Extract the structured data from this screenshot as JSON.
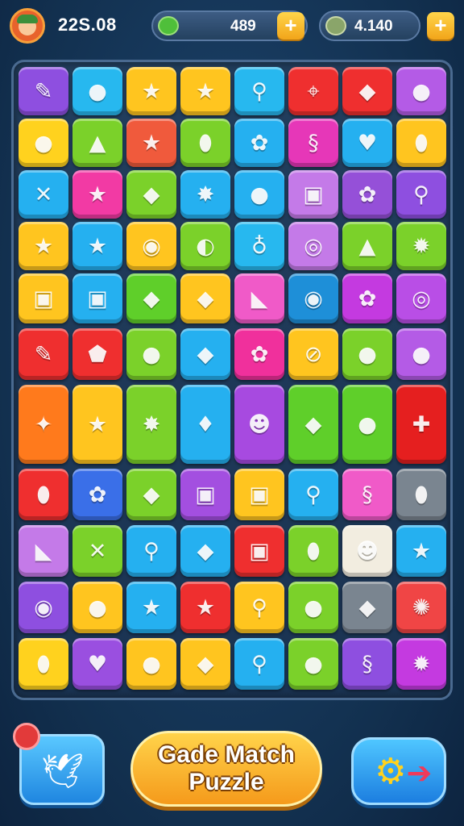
{
  "header": {
    "score": "22S.08",
    "currency1": "489",
    "currency2": "4.140",
    "plus_label": "+",
    "avatar_icon": "boy-avatar-icon",
    "currency1_icon": "leaf-gem-icon",
    "currency2_icon": "coin-bag-icon"
  },
  "board": {
    "rows": [
      [
        [
          "#8e4fe0",
          "✎"
        ],
        [
          "#27b8ef",
          "●"
        ],
        [
          "#ffc51f",
          "★"
        ],
        [
          "#ffc51f",
          "★"
        ],
        [
          "#27b8ef",
          "⚲"
        ],
        [
          "#ef2f2f",
          "⌖"
        ],
        [
          "#ef2f2f",
          "◆"
        ],
        [
          "#b45be6",
          "●"
        ]
      ],
      [
        [
          "#ffd21e",
          "●"
        ],
        [
          "#7bd12a",
          "▲"
        ],
        [
          "#f05a3c",
          "★"
        ],
        [
          "#7bd12a",
          "⬮"
        ],
        [
          "#25b0f0",
          "✿"
        ],
        [
          "#e637b8",
          "§"
        ],
        [
          "#25b0f0",
          "♥"
        ],
        [
          "#ffc51f",
          "⬮"
        ]
      ],
      [
        [
          "#25b0f0",
          "✕"
        ],
        [
          "#f23aa4",
          "★"
        ],
        [
          "#7bd12a",
          "◆"
        ],
        [
          "#25b0f0",
          "✸"
        ],
        [
          "#25b0f0",
          "●"
        ],
        [
          "#c47ae8",
          "▣"
        ],
        [
          "#9550d8",
          "✿"
        ],
        [
          "#8e4fe0",
          "⚲"
        ]
      ],
      [
        [
          "#ffc51f",
          "★"
        ],
        [
          "#25b0f0",
          "★"
        ],
        [
          "#ffc51f",
          "◉"
        ],
        [
          "#7bd12a",
          "◐"
        ],
        [
          "#27b8ef",
          "♁"
        ],
        [
          "#c47ae8",
          "◎"
        ],
        [
          "#7bd12a",
          "▲"
        ],
        [
          "#7bd12a",
          "✹"
        ]
      ],
      [
        [
          "#ffc51f",
          "▣"
        ],
        [
          "#25b0f0",
          "▣"
        ],
        [
          "#5fcf2a",
          "◆"
        ],
        [
          "#ffc51f",
          "◆"
        ],
        [
          "#f05ac8",
          "◣"
        ],
        [
          "#1e8fd8",
          "◉"
        ],
        [
          "#c43ae0",
          "✿"
        ],
        [
          "#b94ee6",
          "◎"
        ]
      ],
      [
        [
          "#ef2f2f",
          "✎"
        ],
        [
          "#ef2f2f",
          "⬟"
        ],
        [
          "#7bd12a",
          "●"
        ],
        [
          "#25b0f0",
          "◆"
        ],
        [
          "#f0309c",
          "✿"
        ],
        [
          "#ffc51f",
          "⊘"
        ],
        [
          "#7bd12a",
          "●"
        ],
        [
          "#b45be6",
          "●"
        ]
      ],
      [
        [
          "#ff7a1c",
          "✦"
        ],
        [
          "#ffc51f",
          "★"
        ],
        [
          "#7bd12a",
          "✸"
        ],
        [
          "#25b0f0",
          "♦"
        ],
        [
          "#a74ae0",
          "☻"
        ],
        [
          "#5fcf2a",
          "◆"
        ],
        [
          "#5fcf2a",
          "●"
        ],
        [
          "#e51f1f",
          "✚"
        ]
      ],
      [
        [
          "#ef2f2f",
          "⬮"
        ],
        [
          "#3a6fe8",
          "✿"
        ],
        [
          "#7bd12a",
          "◆"
        ],
        [
          "#a34fe0",
          "▣"
        ],
        [
          "#ffc51f",
          "▣"
        ],
        [
          "#25b0f0",
          "⚲"
        ],
        [
          "#f05ac8",
          "§"
        ],
        [
          "#7a8590",
          "⬮"
        ]
      ],
      [
        [
          "#c47ae8",
          "◣"
        ],
        [
          "#7bd12a",
          "✕"
        ],
        [
          "#25b0f0",
          "⚲"
        ],
        [
          "#25b0f0",
          "◆"
        ],
        [
          "#ef2f2f",
          "▣"
        ],
        [
          "#7bd12a",
          "⬮"
        ],
        [
          "#f2ede0",
          "☻"
        ],
        [
          "#25b0f0",
          "★"
        ]
      ],
      [
        [
          "#8e4fe0",
          "◉"
        ],
        [
          "#ffc51f",
          "●"
        ],
        [
          "#25b0f0",
          "★"
        ],
        [
          "#ef2f2f",
          "★"
        ],
        [
          "#ffc51f",
          "⚲"
        ],
        [
          "#7bd12a",
          "●"
        ],
        [
          "#7a8590",
          "◆"
        ],
        [
          "#f04545",
          "✺"
        ]
      ],
      [
        [
          "#ffd21e",
          "⬮"
        ],
        [
          "#9a4fe0",
          "♥"
        ],
        [
          "#ffc51f",
          "●"
        ],
        [
          "#ffc51f",
          "◆"
        ],
        [
          "#25b0f0",
          "⚲"
        ],
        [
          "#7bd12a",
          "●"
        ],
        [
          "#8e4fe0",
          "§"
        ],
        [
          "#c43ae0",
          "✹"
        ]
      ]
    ]
  },
  "footer": {
    "title_line1": "Gade Match",
    "title_line2": "Puzzle",
    "left_icon": "bird-friends-icon",
    "right_icon": "gear-arrow-icon",
    "badge_icon": "notification-badge-icon"
  },
  "colors": {
    "background": "#143256",
    "accent": "#ffc51f",
    "button_blue": "#25b0f0"
  }
}
